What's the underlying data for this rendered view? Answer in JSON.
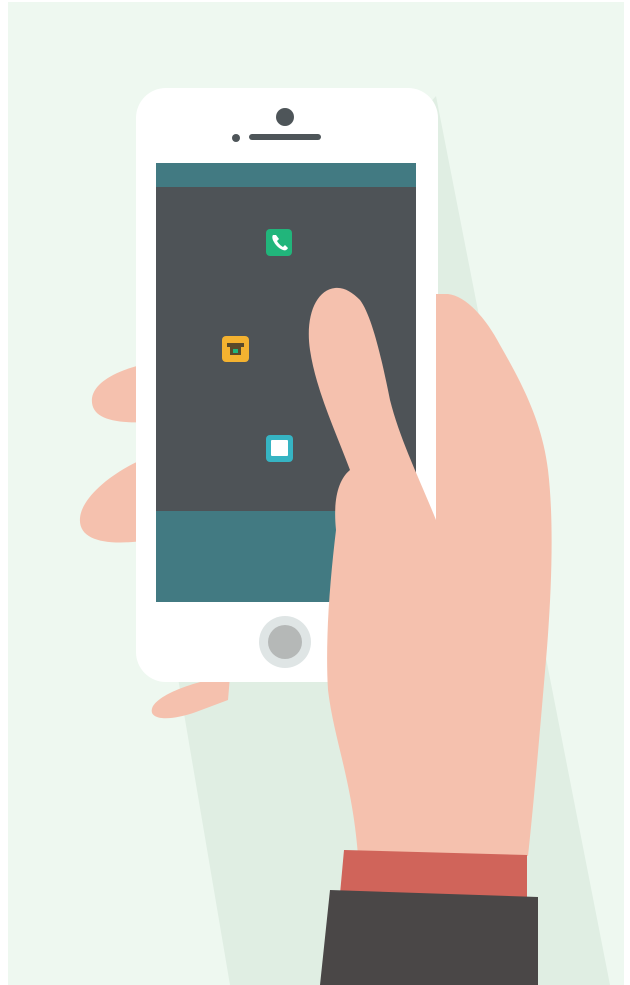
{
  "scene": {
    "description_free": true
  },
  "colors": {
    "page_bg": "#ffffff",
    "backdrop": "#eef8f0",
    "shadow": "#e0eee3",
    "phone_body": "#ffffff",
    "phone_dark": "#4e5559",
    "screen_bar": "#427a82",
    "screen_main": "#4e5357",
    "home_ring": "#dfe5e5",
    "home_button": "#b5b8b7",
    "skin": "#f5c1ae",
    "cuff": "#d0645a",
    "sleeve": "#4a4747"
  },
  "apps": [
    {
      "name": "phone-app-icon",
      "color": "#21b57b",
      "glyph": "phone-icon"
    },
    {
      "name": "printer-app-icon",
      "color": "#f4b230",
      "glyph": "printer-icon"
    },
    {
      "name": "window-app-icon",
      "color": "#36b4c3",
      "glyph": "window-icon"
    }
  ]
}
